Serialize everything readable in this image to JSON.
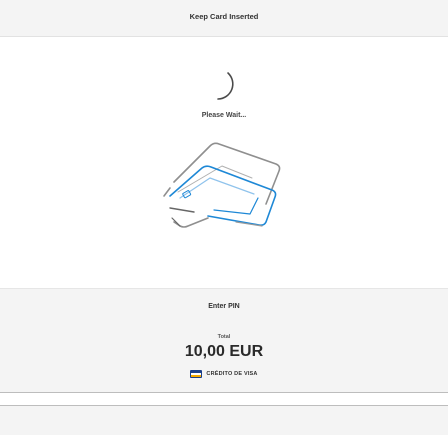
{
  "header": {
    "title": "Keep Card Inserted"
  },
  "status": {
    "wait_text": "Please Wait..."
  },
  "pin_panel": {
    "label": "Enter PIN",
    "total_label": "Total",
    "amount": "10,00 EUR",
    "payment_method": "CRÉDITO DE VISA",
    "payment_icon": "visa-card-icon",
    "pin_value": ""
  },
  "colors": {
    "header_bg": "#f4f4f4",
    "panel_bg": "#f4f4f4",
    "illustration_stroke": "#1e88d6",
    "visa_blue": "#1a3f8a",
    "visa_gold": "#f2a900"
  }
}
